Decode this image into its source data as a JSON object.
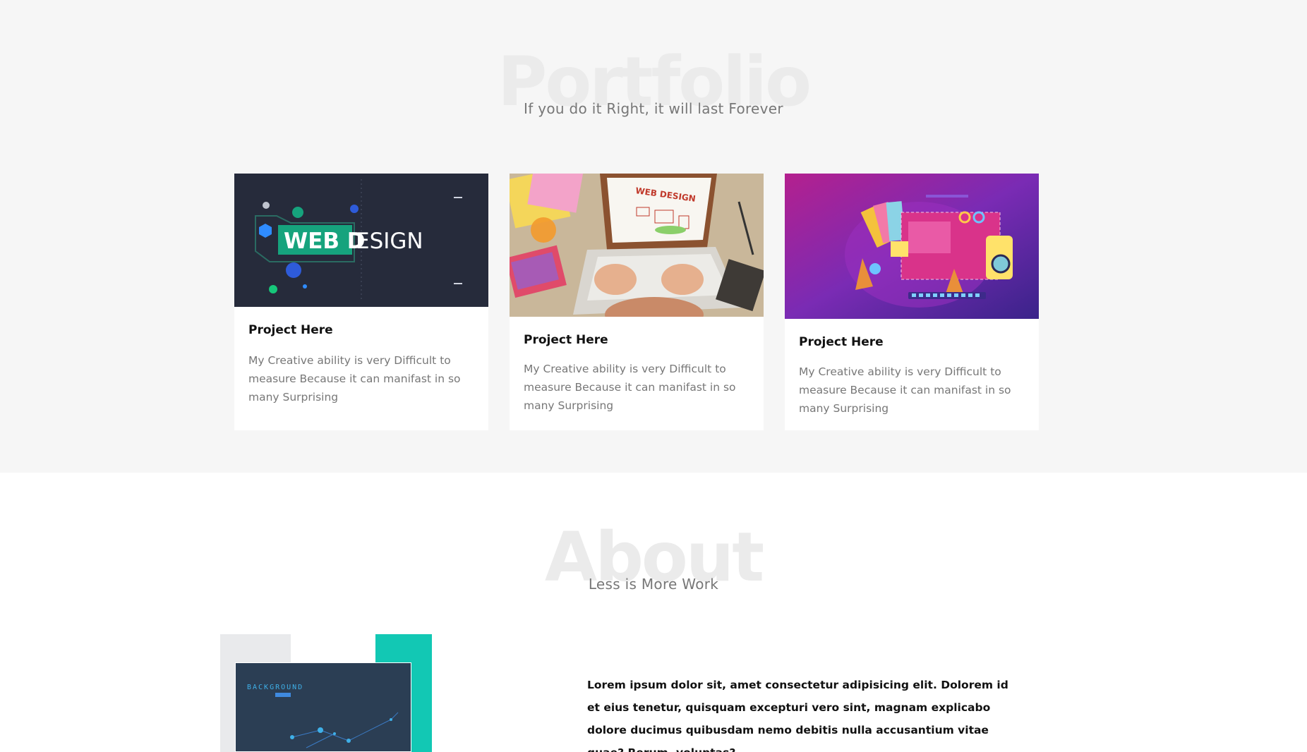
{
  "portfolio": {
    "heading": "Portfolio",
    "subtitle": "If you do it Right, it will last Forever",
    "cards": [
      {
        "image_icon": "web-design-banner-image",
        "banner_text_bold": "WEB D",
        "banner_text_light": "ESIGN",
        "title": "Project Here",
        "description": "My Creative ability is very Difficult to measure Because it can manifast in so many Surprising"
      },
      {
        "image_icon": "laptop-web-design-photo",
        "screen_text": "WEB DESIGN",
        "title": "Project Here",
        "description": "My Creative ability is very Difficult to measure Because it can manifast in so many Surprising"
      },
      {
        "image_icon": "design-tools-illustration",
        "title": "Project Here",
        "description": "My Creative ability is very Difficult to measure Because it can manifast in so many Surprising"
      }
    ]
  },
  "about": {
    "heading": "About",
    "subtitle": "Less is More Work",
    "image_icon": "background-mockup-image",
    "image_caption": "BACKGROUND",
    "body": "Lorem ipsum dolor sit, amet consectetur adipisicing elit. Dolorem id et eius tenetur, quisquam excepturi vero sint, magnam explicabo dolore ducimus quibusdam nemo debitis nulla accusantium vitae quae? Rerum, voluptas?"
  },
  "colors": {
    "page_bg": "#f6f6f6",
    "card_bg": "#ffffff",
    "accent_teal": "#12c8b4",
    "web_design_green": "#16a37d",
    "dark_navy": "#262b3b",
    "purple": "#8a2bb0"
  }
}
